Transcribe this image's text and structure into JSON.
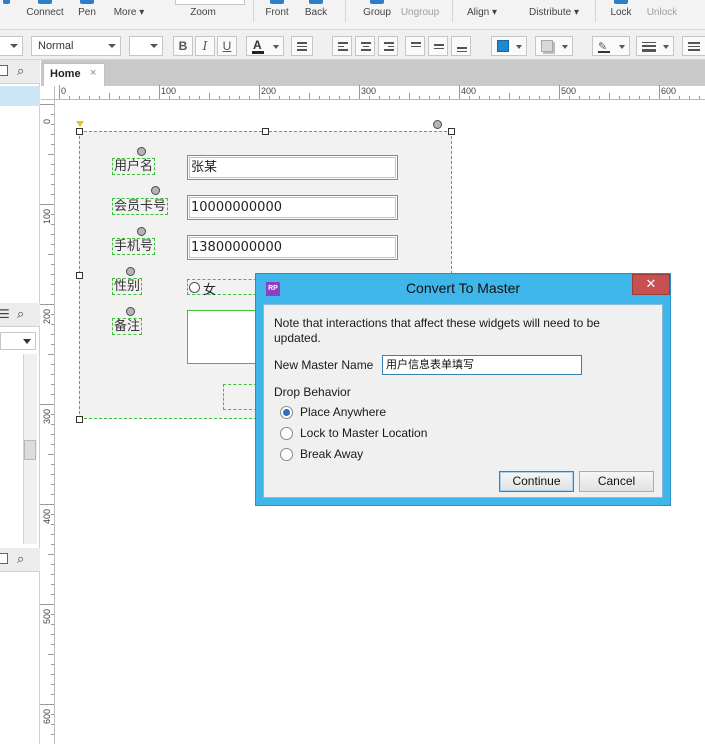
{
  "toolbar": {
    "items": [
      {
        "label": "Connect",
        "dim": false
      },
      {
        "label": "Pen",
        "dim": false
      },
      {
        "label": "More ▾",
        "dim": false
      },
      {
        "label": "Zoom",
        "dim": false
      },
      {
        "label": "Front",
        "dim": false
      },
      {
        "label": "Back",
        "dim": false
      },
      {
        "label": "Group",
        "dim": false
      },
      {
        "label": "Ungroup",
        "dim": true
      },
      {
        "label": "Align ▾",
        "dim": false
      },
      {
        "label": "Distribute ▾",
        "dim": false
      },
      {
        "label": "Lock",
        "dim": false
      },
      {
        "label": "Unlock",
        "dim": true
      }
    ]
  },
  "format_bar": {
    "style_value": "Normal",
    "bold": "B",
    "italic": "I",
    "underline": "U",
    "font_color_glyph": "A",
    "fill_color": "#1e88d2"
  },
  "tabs": [
    {
      "label": "Home",
      "close": "×"
    }
  ],
  "ruler": {
    "top": [
      "0",
      "100",
      "200",
      "300",
      "400",
      "500",
      "600"
    ],
    "left": [
      "0",
      "100",
      "200",
      "300",
      "400",
      "500",
      "600"
    ]
  },
  "form": {
    "name_label": "用户名",
    "name_value": "张某",
    "card_label": "会员卡号",
    "card_value": "10000000000",
    "phone_label": "手机号",
    "phone_value": "13800000000",
    "gender_label": "性别",
    "gender_option": "女",
    "remark_label": "备注"
  },
  "dialog": {
    "title": "Convert To Master",
    "icon_text": "RP",
    "close_glyph": "✕",
    "note": "Note that interactions that affect these widgets will need to be updated.",
    "name_label": "New Master Name",
    "name_value": "用户信息表单填写",
    "drop_label": "Drop Behavior",
    "options": [
      {
        "label": "Place Anywhere",
        "selected": true
      },
      {
        "label": "Lock to Master Location",
        "selected": false
      },
      {
        "label": "Break Away",
        "selected": false
      }
    ],
    "continue_label": "Continue",
    "cancel_label": "Cancel"
  },
  "colors": {
    "dialog_frame": "#3fb6ea",
    "close_button": "#c75050",
    "selection_dash": "#39c139",
    "accent": "#2f7dc8"
  }
}
